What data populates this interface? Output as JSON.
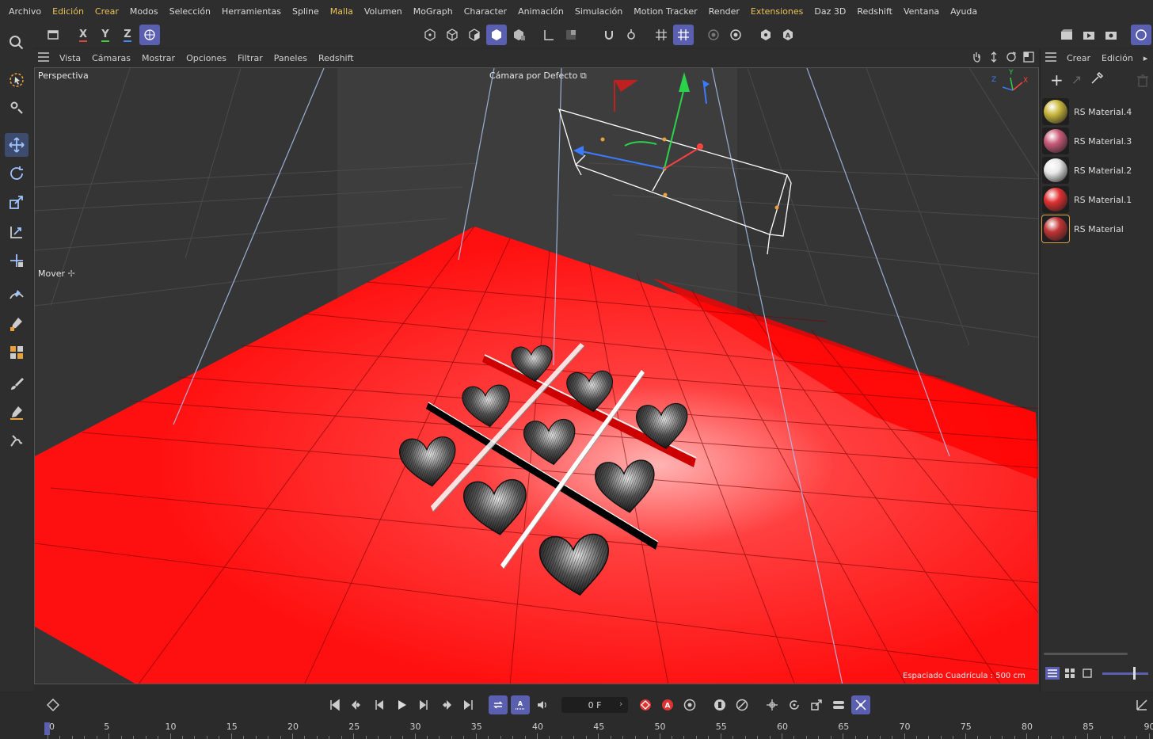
{
  "menu": [
    "Archivo",
    "Edición",
    "Crear",
    "Modos",
    "Selección",
    "Herramientas",
    "Spline",
    "Malla",
    "Volumen",
    "MoGraph",
    "Character",
    "Animación",
    "Simulación",
    "Motion Tracker",
    "Render",
    "Extensiones",
    "Daz 3D",
    "Redshift",
    "Ventana",
    "Ayuda"
  ],
  "menu_highlight": [
    "Edición",
    "Crear",
    "Malla",
    "Extensiones"
  ],
  "toolbar": {
    "axis_x": "X",
    "axis_y": "Y",
    "axis_z": "Z"
  },
  "viewport": {
    "menu": [
      "Vista",
      "Cámaras",
      "Mostrar",
      "Opciones",
      "Filtrar",
      "Paneles",
      "Redshift"
    ],
    "view_name": "Perspectiva",
    "camera_name": "Cámara por Defecto",
    "active_tool": "Mover",
    "grid_spacing": "Espaciado Cuadrícula : 500 cm",
    "gizmo": {
      "x": "X",
      "y": "Y",
      "z": "Z"
    }
  },
  "materials": {
    "menu": [
      "Crear",
      "Edición"
    ],
    "items": [
      {
        "name": "RS Material.4",
        "color": "#c9b73c"
      },
      {
        "name": "RS Material.3",
        "color": "#c95a78"
      },
      {
        "name": "RS Material.2",
        "color": "#e8e8e8"
      },
      {
        "name": "RS Material.1",
        "color": "#e03030"
      },
      {
        "name": "RS Material",
        "color": "#c23434"
      }
    ],
    "selected_index": 4
  },
  "timeline": {
    "current_frame": "0 F",
    "ruler_labels": [
      "0",
      "5",
      "10",
      "15",
      "20",
      "25",
      "30",
      "35",
      "40",
      "45",
      "50",
      "55",
      "60",
      "65",
      "70",
      "75",
      "80",
      "85",
      "90"
    ]
  },
  "colors": {
    "accent": "#5a5fb0",
    "floor": "#ff1a1a",
    "menu_highlight": "#e9c25a"
  }
}
